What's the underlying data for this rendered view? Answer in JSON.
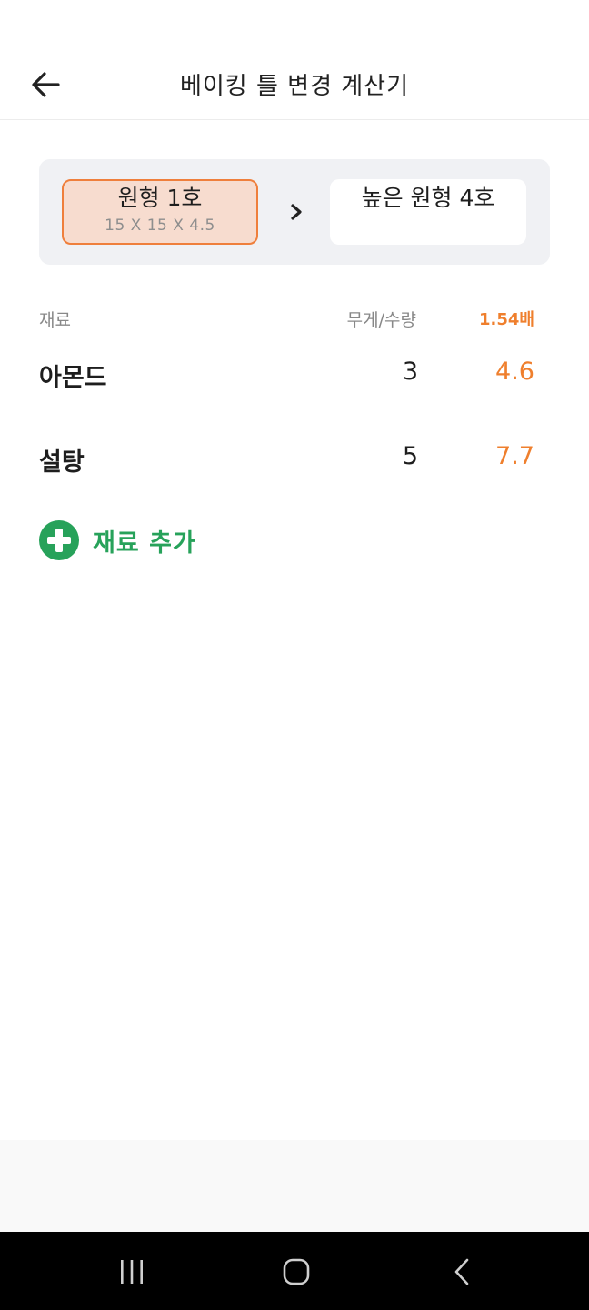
{
  "header": {
    "title": "베이킹 틀 변경 계산기",
    "back_icon": "arrow-left-icon"
  },
  "pans": {
    "source": {
      "name": "원형 1호",
      "dimensions": "15 X 15 X 4.5",
      "selected": true
    },
    "target": {
      "name": "높은 원형 4호",
      "dimensions": ""
    },
    "arrow_icon": "chevron-right-icon"
  },
  "table": {
    "col_name": "재료",
    "col_qty": "무게/수량",
    "col_ratio": "1.54배",
    "rows": [
      {
        "name": "아몬드",
        "qty": "3",
        "result": "4.6"
      },
      {
        "name": "설탕",
        "qty": "5",
        "result": "7.7"
      }
    ]
  },
  "add_ingredient": {
    "label": "재료 추가",
    "icon": "plus-circle-icon"
  },
  "colors": {
    "accent_orange": "#ef7f2d",
    "accent_green": "#27a25a",
    "selected_bg": "#f7dccf"
  },
  "navbar": {
    "recents_icon": "recents-icon",
    "home_icon": "home-icon",
    "back_icon": "nav-back-icon"
  }
}
